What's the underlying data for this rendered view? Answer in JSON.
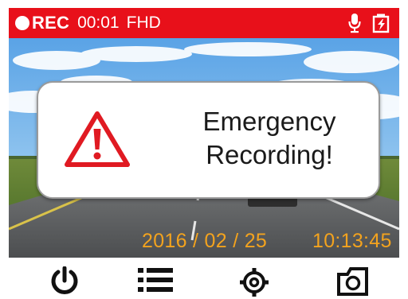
{
  "status_bar": {
    "rec_label": "REC",
    "elapsed_time": "00:01",
    "resolution": "FHD",
    "background_color": "#e8101a",
    "icons": [
      "mic-icon",
      "battery-charging-icon"
    ]
  },
  "alert": {
    "line1": "Emergency",
    "line2": "Recording!",
    "icon": "warning-triangle-icon",
    "icon_color": "#e01a22"
  },
  "osd": {
    "date": "2016 / 02 / 25",
    "time": "10:13:45",
    "color": "#f3a31e"
  },
  "bottom_bar": {
    "buttons": [
      "power-icon",
      "menu-icon",
      "settings-icon",
      "camera-icon"
    ]
  }
}
